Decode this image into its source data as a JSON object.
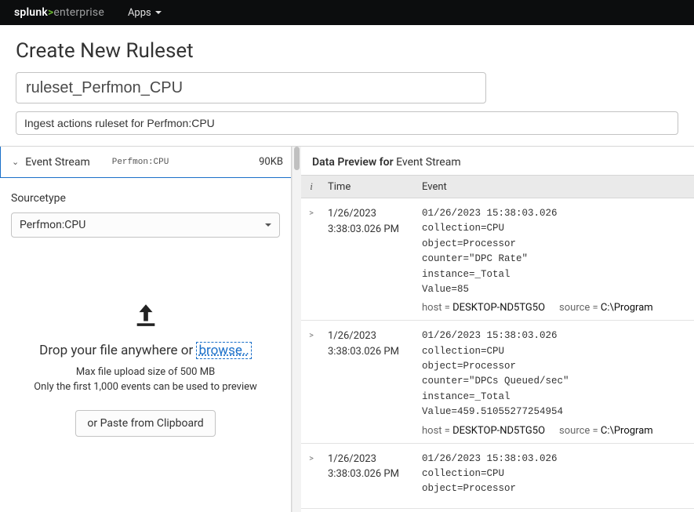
{
  "navbar": {
    "brand_a": "splunk",
    "brand_gt": ">",
    "brand_b": "enterprise",
    "apps_label": "Apps"
  },
  "header": {
    "title": "Create New Ruleset",
    "name_value": "ruleset_Perfmon_CPU",
    "desc_value": "Ingest actions ruleset for Perfmon:CPU"
  },
  "left": {
    "event_stream_label": "Event Stream",
    "event_stream_mono": "Perfmon:CPU",
    "event_stream_size": "90KB",
    "sourcetype_label": "Sourcetype",
    "sourcetype_value": "Perfmon:CPU",
    "drop_headline_a": "Drop your file anywhere or ",
    "browse_label": "browse..",
    "max_label": "Max file upload size of 500 MB",
    "preview_limit_label": "Only the first 1,000 events can be used to preview",
    "paste_label": "or Paste from Clipboard"
  },
  "right": {
    "preview_prefix": "Data Preview for ",
    "preview_stream": "Event Stream",
    "col_i": "i",
    "col_time": "Time",
    "col_event": "Event",
    "host_key": "host = ",
    "source_key": "source = ",
    "rows": [
      {
        "date": "1/26/2023",
        "time": "3:38:03.026 PM",
        "raw": "01/26/2023 15:38:03.026\ncollection=CPU\nobject=Processor\ncounter=\"DPC Rate\"\ninstance=_Total\nValue=85",
        "host": "DESKTOP-ND5TG5O",
        "source": "C:\\Program"
      },
      {
        "date": "1/26/2023",
        "time": "3:38:03.026 PM",
        "raw": "01/26/2023 15:38:03.026\ncollection=CPU\nobject=Processor\ncounter=\"DPCs Queued/sec\"\ninstance=_Total\nValue=459.51055277254954",
        "host": "DESKTOP-ND5TG5O",
        "source": "C:\\Program"
      },
      {
        "date": "1/26/2023",
        "time": "3:38:03.026 PM",
        "raw": "01/26/2023 15:38:03.026\ncollection=CPU\nobject=Processor",
        "host": "",
        "source": ""
      }
    ]
  }
}
